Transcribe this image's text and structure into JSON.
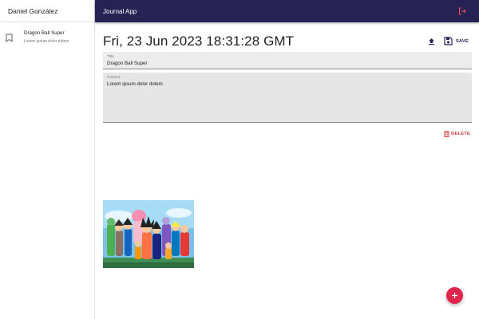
{
  "sidebar": {
    "user_name": "Daniel González",
    "entries": [
      {
        "title": "Dragon Ball Super",
        "snippet": "Lorem ipsum dolor dolem",
        "icon": "bookmark-icon"
      }
    ]
  },
  "appbar": {
    "title": "Journal App",
    "logout_icon": "logout-icon",
    "background": "#262254"
  },
  "note": {
    "date": "Fri, 23 Jun 2023 18:31:28 GMT",
    "save_label": "SAVE",
    "title_field": {
      "label": "Title",
      "value": "Dragon Ball Super"
    },
    "content_field": {
      "label": "Content",
      "value": "Lorem ipsum dolor dolem"
    },
    "delete_label": "DELETE"
  },
  "gallery": {
    "images": [
      {
        "name": "dragon-ball-characters-image"
      }
    ]
  },
  "fab": {
    "icon": "plus-icon",
    "color": "#e0264b"
  }
}
